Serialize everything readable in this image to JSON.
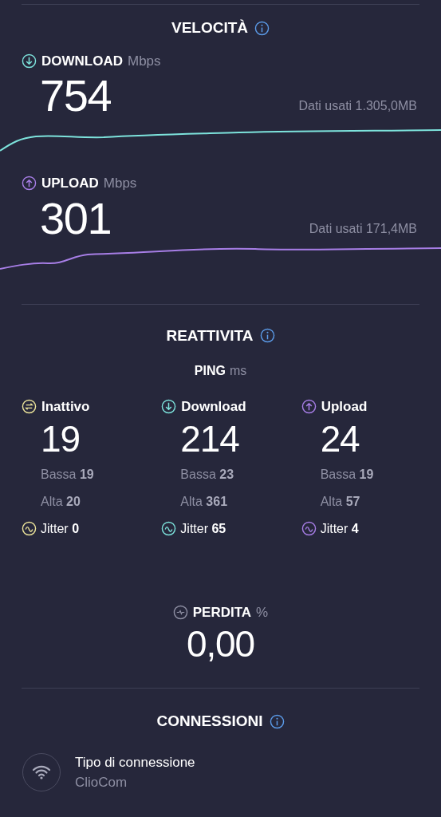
{
  "speed": {
    "title": "VELOCITÀ",
    "metrics": [
      {
        "kind": "down",
        "label": "DOWNLOAD",
        "unit": "Mbps",
        "value": "754",
        "data_used": "Dati usati 1.305,0MB",
        "color": "#7de3dc"
      },
      {
        "kind": "up",
        "label": "UPLOAD",
        "unit": "Mbps",
        "value": "301",
        "data_used": "Dati usati 171,4MB",
        "color": "#a77ee6"
      }
    ]
  },
  "responsiveness": {
    "title": "REATTIVITA",
    "ping_label": "PING",
    "ping_unit": "ms",
    "columns": [
      {
        "kind": "idle",
        "label": "Inattivo",
        "value": "19",
        "low_label": "Bassa",
        "low": "19",
        "high_label": "Alta",
        "high": "20",
        "jitter_label": "Jitter",
        "jitter": "0",
        "color": "#ece49a"
      },
      {
        "kind": "down",
        "label": "Download",
        "value": "214",
        "low_label": "Bassa",
        "low": "23",
        "high_label": "Alta",
        "high": "361",
        "jitter_label": "Jitter",
        "jitter": "65",
        "color": "#7de3dc"
      },
      {
        "kind": "up",
        "label": "Upload",
        "value": "24",
        "low_label": "Bassa",
        "low": "19",
        "high_label": "Alta",
        "high": "57",
        "jitter_label": "Jitter",
        "jitter": "4",
        "color": "#a77ee6"
      }
    ]
  },
  "loss": {
    "label": "PERDITA",
    "unit": "%",
    "value": "0,00"
  },
  "connections": {
    "title": "CONNESSIONI",
    "type_label": "Tipo di connessione",
    "provider": "ClioCom"
  }
}
